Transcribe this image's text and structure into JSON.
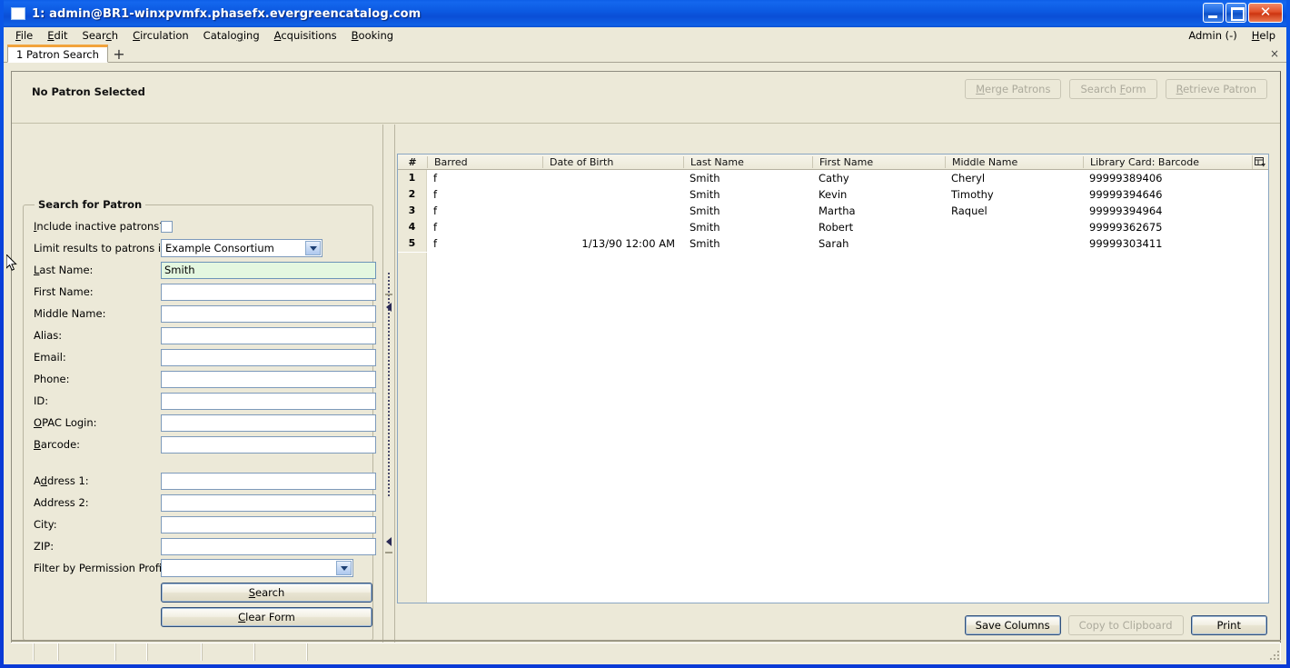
{
  "window": {
    "title": "1: admin@BR1-winxpvmfx.phasefx.evergreencatalog.com",
    "minimize_label": "Minimize",
    "maximize_label": "Maximize",
    "close_label": "✕"
  },
  "menubar": {
    "items": [
      {
        "label": "File",
        "accel": "F"
      },
      {
        "label": "Edit",
        "accel": "E"
      },
      {
        "label": "Search",
        "accel": "c"
      },
      {
        "label": "Circulation",
        "accel": "C"
      },
      {
        "label": "Cataloging",
        "accel": "g"
      },
      {
        "label": "Acquisitions",
        "accel": "A"
      },
      {
        "label": "Booking",
        "accel": "B"
      }
    ],
    "right_items": [
      {
        "label": "Admin (-)"
      },
      {
        "label": "Help"
      }
    ]
  },
  "tabs": {
    "active": "1 Patron Search",
    "active_index": "1",
    "active_title": "Patron Search",
    "add_label": "+",
    "close_all_label": "×"
  },
  "patron_header": {
    "status": "No Patron Selected",
    "buttons": [
      {
        "label": "Merge Patrons",
        "disabled": true
      },
      {
        "label": "Search Form",
        "disabled": true
      },
      {
        "label": "Retrieve Patron",
        "disabled": true
      }
    ],
    "merge_label": "Merge Patrons",
    "search_form_label": "Search Form",
    "retrieve_label": "Retrieve Patron"
  },
  "search_form": {
    "legend": "Search for Patron",
    "include_inactive_label": "Include inactive patrons?",
    "include_inactive_checked": false,
    "limit_results_label": "Limit results to patrons in",
    "limit_results_value": "Example Consortium",
    "fields": [
      {
        "label": "Last Name:",
        "value": "Smith",
        "focused": true
      },
      {
        "label": "First Name:",
        "value": "",
        "focused": false
      },
      {
        "label": "Middle Name:",
        "value": "",
        "focused": false
      },
      {
        "label": "Alias:",
        "value": "",
        "focused": false
      },
      {
        "label": "Email:",
        "value": "",
        "focused": false
      },
      {
        "label": "Phone:",
        "value": "",
        "focused": false
      },
      {
        "label": "ID:",
        "value": "",
        "focused": false
      },
      {
        "label": "OPAC Login:",
        "value": "",
        "focused": false
      },
      {
        "label": "Barcode:",
        "value": "",
        "focused": false
      }
    ],
    "address_fields": [
      {
        "label": "Address 1:",
        "value": ""
      },
      {
        "label": "Address 2:",
        "value": ""
      },
      {
        "label": "City:",
        "value": ""
      },
      {
        "label": "ZIP:",
        "value": ""
      }
    ],
    "permission_profile_label": "Filter by Permission Profile:",
    "permission_profile_value": "",
    "search_button": "Search",
    "clear_button": "Clear Form"
  },
  "results": {
    "columns": [
      "#",
      "Barred",
      "Date of Birth",
      "Last Name",
      "First Name",
      "Middle Name",
      "Library Card: Barcode"
    ],
    "col_num": "#",
    "col_barred": "Barred",
    "col_dob": "Date of Birth",
    "col_last": "Last Name",
    "col_first": "First Name",
    "col_middle": "Middle Name",
    "col_card": "Library Card: Barcode",
    "rows": [
      {
        "num": "1",
        "barred": "f",
        "dob": "",
        "last": "Smith",
        "first": "Cathy",
        "middle": "Cheryl",
        "card": "99999389406"
      },
      {
        "num": "2",
        "barred": "f",
        "dob": "",
        "last": "Smith",
        "first": "Kevin",
        "middle": "Timothy",
        "card": "99999394646"
      },
      {
        "num": "3",
        "barred": "f",
        "dob": "",
        "last": "Smith",
        "first": "Martha",
        "middle": "Raquel",
        "card": "99999394964"
      },
      {
        "num": "4",
        "barred": "f",
        "dob": "",
        "last": "Smith",
        "first": "Robert",
        "middle": "",
        "card": "99999362675"
      },
      {
        "num": "5",
        "barred": "f",
        "dob": "1/13/90 12:00 AM",
        "last": "Smith",
        "first": "Sarah",
        "middle": "",
        "card": "99999303411"
      }
    ],
    "buttons": {
      "save_columns": "Save Columns",
      "copy_clipboard": "Copy to Clipboard",
      "copy_clipboard_disabled": true,
      "print": "Print"
    }
  },
  "colors": {
    "titlebar_blue": "#0a4ed6",
    "window_chrome": "#ece9d8",
    "tab_accent": "#f2a33c",
    "focused_input_bg": "#e4f7e0",
    "grid_bg": "#ffffff",
    "close_button_red": "#cc3410"
  }
}
